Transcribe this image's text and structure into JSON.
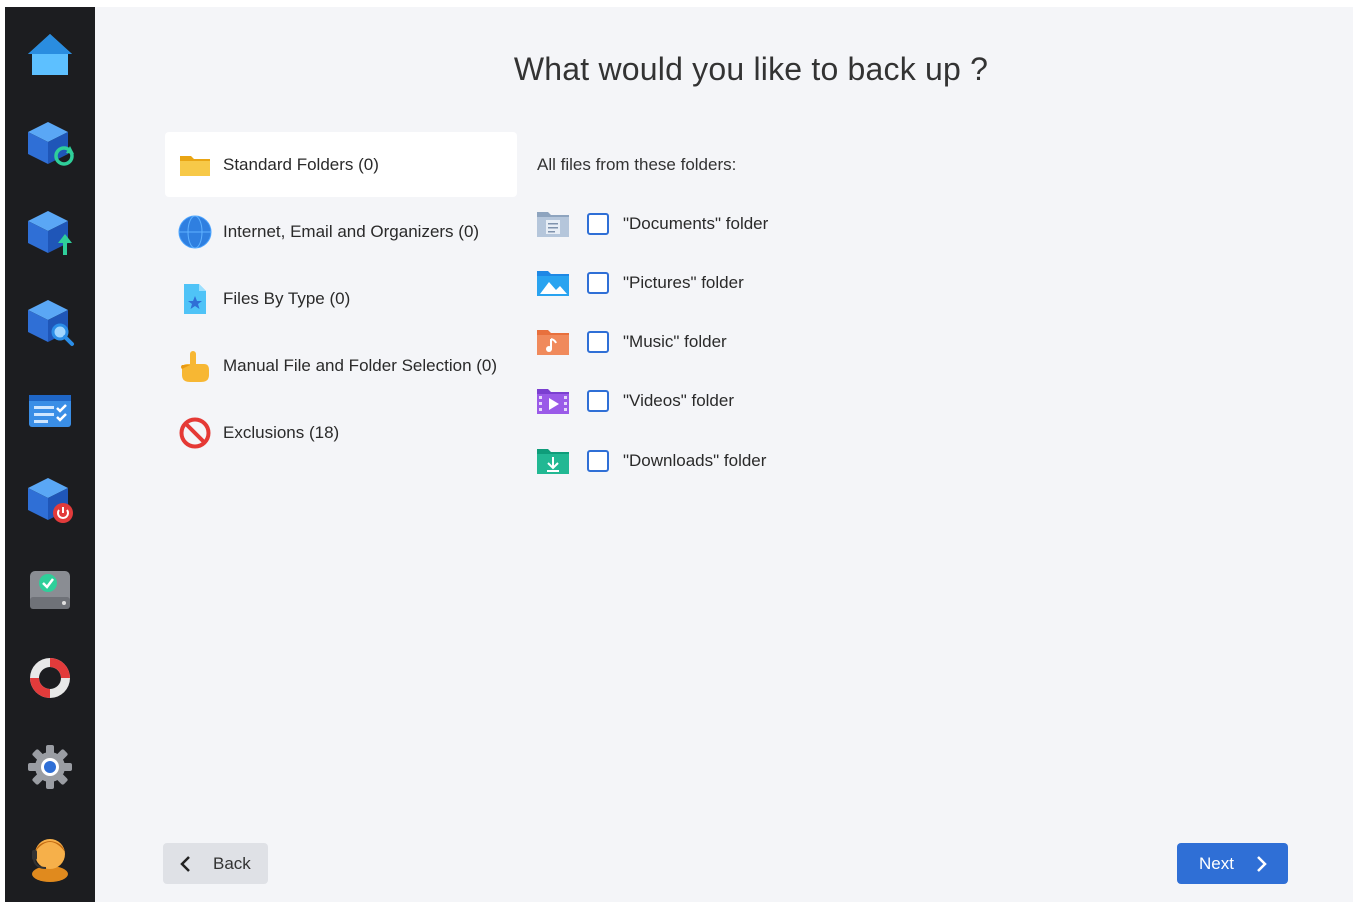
{
  "page": {
    "title": "What would you like to back up ?"
  },
  "colors": {
    "accent": "#2f6fd6",
    "sidebar_bg": "#1c1d20",
    "main_bg": "#f4f5f8"
  },
  "sidebar": {
    "items": [
      {
        "icon": "home-icon"
      },
      {
        "icon": "restore-cube-icon"
      },
      {
        "icon": "upload-cube-icon"
      },
      {
        "icon": "search-cube-icon"
      },
      {
        "icon": "task-list-icon"
      },
      {
        "icon": "power-cube-icon"
      },
      {
        "icon": "drive-check-icon"
      },
      {
        "icon": "lifebuoy-icon"
      },
      {
        "icon": "gear-icon"
      },
      {
        "icon": "support-agent-icon"
      }
    ]
  },
  "categories": [
    {
      "label": "Standard Folders (0)",
      "icon": "folder-icon",
      "active": true
    },
    {
      "label": "Internet, Email and Organizers (0)",
      "icon": "globe-icon",
      "active": false
    },
    {
      "label": "Files By Type (0)",
      "icon": "star-file-icon",
      "active": false
    },
    {
      "label": "Manual File and Folder Selection (0)",
      "icon": "pointing-hand-icon",
      "active": false
    },
    {
      "label": "Exclusions (18)",
      "icon": "prohibited-icon",
      "active": false
    }
  ],
  "folders": {
    "heading": "All files from these folders:",
    "items": [
      {
        "label": "\"Documents\" folder",
        "icon": "documents-folder-icon",
        "checked": false
      },
      {
        "label": "\"Pictures\" folder",
        "icon": "pictures-folder-icon",
        "checked": false
      },
      {
        "label": "\"Music\" folder",
        "icon": "music-folder-icon",
        "checked": false
      },
      {
        "label": "\"Videos\" folder",
        "icon": "videos-folder-icon",
        "checked": false
      },
      {
        "label": "\"Downloads\" folder",
        "icon": "downloads-folder-icon",
        "checked": false
      }
    ]
  },
  "footer": {
    "back_label": "Back",
    "next_label": "Next"
  }
}
